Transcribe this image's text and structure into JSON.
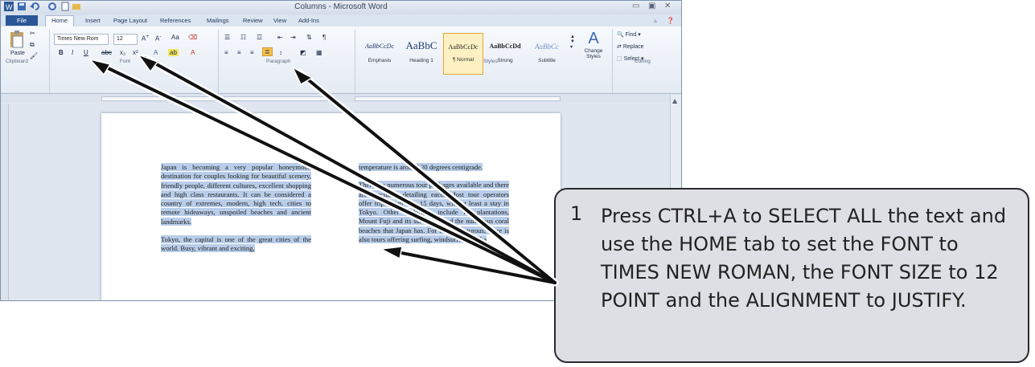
{
  "window": {
    "title": "Columns - Microsoft Word",
    "controls": {
      "minimize": "▭",
      "restore": "▣",
      "close": "✕"
    }
  },
  "tabs": [
    "File",
    "Home",
    "Insert",
    "Page Layout",
    "References",
    "Mailings",
    "Review",
    "View",
    "Add-Ins"
  ],
  "ribbon": {
    "clipboard": {
      "paste_label": "Paste",
      "group_label": "Clipboard"
    },
    "font": {
      "font_name": "Times New Rom",
      "font_size": "12",
      "group_label": "Font"
    },
    "paragraph": {
      "group_label": "Paragraph"
    },
    "styles": {
      "group_label": "Styles",
      "items": [
        {
          "sample": "AaBbCcDc",
          "name": "Emphasis"
        },
        {
          "sample": "AaBbC",
          "name": "Heading 1"
        },
        {
          "sample": "AaBbCcDc",
          "name": "¶ Normal"
        },
        {
          "sample": "AaBbCcDd",
          "name": "Strong"
        },
        {
          "sample": "AaBbCc",
          "name": "Subtitle"
        }
      ],
      "change_styles": "Change Styles"
    },
    "editing": {
      "group_label": "Editing",
      "find": "Find",
      "replace": "Replace",
      "select": "Select"
    }
  },
  "document": {
    "col1": [
      "Japan is becoming a very popular honeymoon destination for couples looking for beautiful scenery, friendly people, different cultures, excellent shopping and high class restaurants. It can be considered a country of extremes, modern, high tech. cities to remote hideaways, unspoiled beaches and ancient landmarks.",
      "Tokyo, the capital is one of the great cities of the world. Busy, vibrant and exciting,"
    ],
    "col2": [
      "temperature is around 20 degrees centigrade.",
      "There are numerous tour packages available and there are brochures detailing each. Most tour operators offer trips from 6 to 15 days, with at least a stay in Tokyo. Other highlights include tea plantations, Mount Fuji and its surrounds and the numerous coral beaches that Japan has. For the adventurous, there is also tours offering surfing, windsurfing, scuba"
    ]
  },
  "instruction": {
    "step_number": "1",
    "text": "Press CTRL+A to SELECT ALL the text and use the HOME tab to set the FONT to TIMES NEW ROMAN, the FONT SIZE to 12 POINT and the ALIGNMENT to JUSTIFY."
  }
}
